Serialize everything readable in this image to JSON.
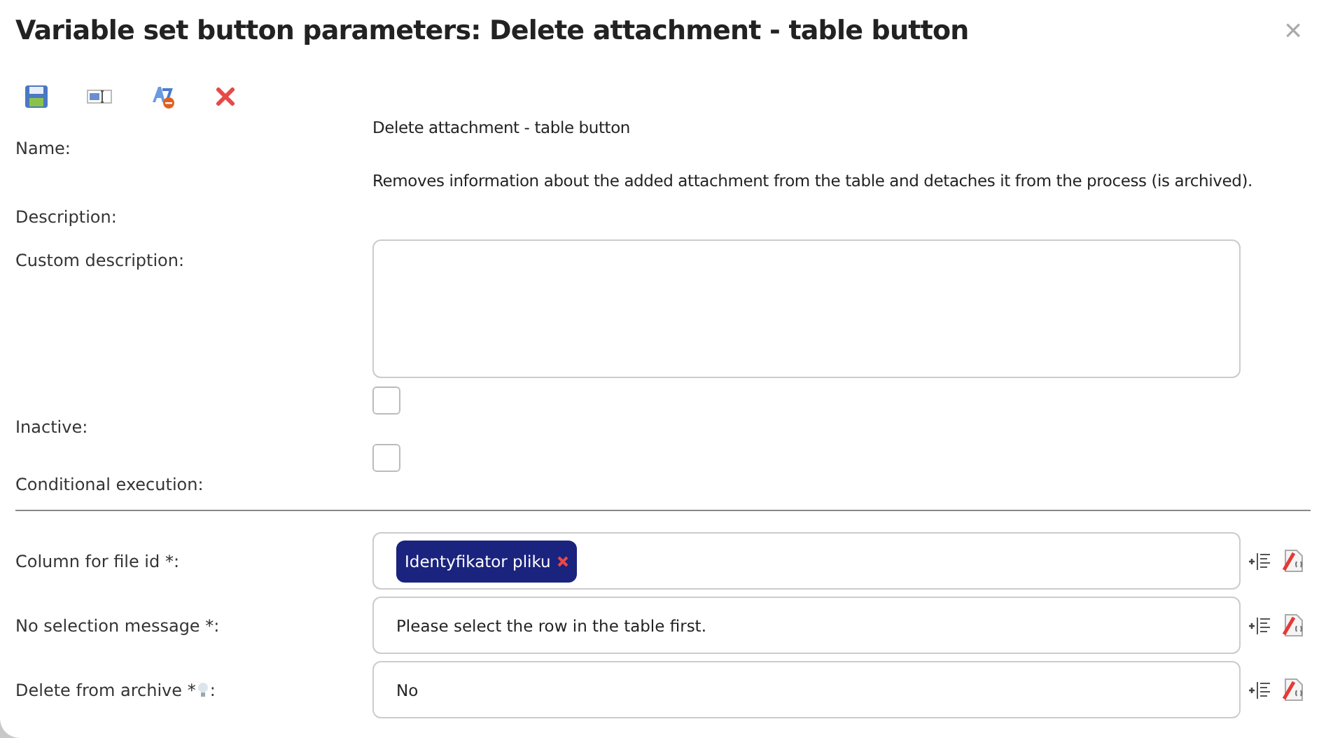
{
  "dialog": {
    "title": "Variable set button parameters: Delete attachment - table button",
    "close": "×"
  },
  "toolbar": [
    {
      "kind": "save"
    },
    {
      "kind": "field"
    },
    {
      "kind": "translate"
    },
    {
      "kind": "delete"
    }
  ],
  "fields": [
    {
      "kind": "text",
      "label": "Name:",
      "value": "Delete attachment - table button"
    },
    {
      "kind": "text",
      "label": "Description:",
      "value": "Removes information about the added attachment from the table and detaches it from the process (is archived)."
    },
    {
      "kind": "textarea",
      "label": "Custom description:"
    },
    {
      "kind": "checkbox",
      "label": "Inactive:",
      "checked": false
    },
    {
      "kind": "checkbox",
      "label": "Conditional execution:",
      "checked": false
    },
    {
      "kind": "divider"
    },
    {
      "kind": "tags",
      "label": "Column for file id *:",
      "tags": [
        "Identyfikator pliku"
      ]
    },
    {
      "kind": "input",
      "label": "No selection message *:",
      "value": "Please select the row in the table first."
    },
    {
      "kind": "input",
      "label": "Delete from archive *",
      "hint": true,
      "suffix": ":",
      "value": "No"
    }
  ]
}
